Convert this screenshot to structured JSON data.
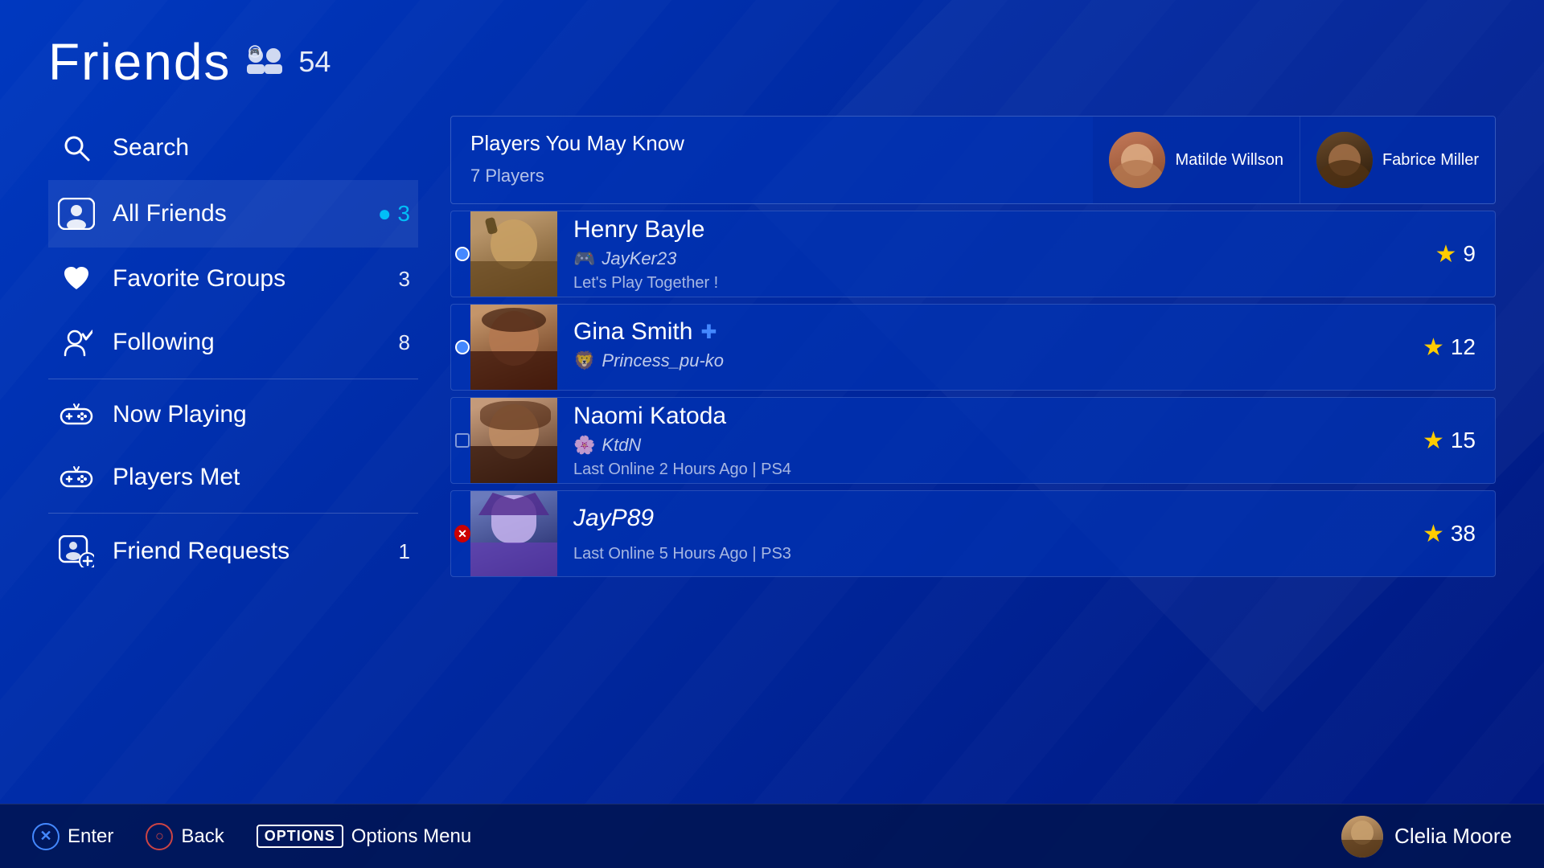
{
  "header": {
    "title": "Friends",
    "icon_label": "friends-icon",
    "count": "54"
  },
  "sidebar": {
    "items": [
      {
        "id": "search",
        "label": "Search",
        "icon": "search",
        "badge": "",
        "badge_type": "none",
        "divider_after": false
      },
      {
        "id": "all-friends",
        "label": "All Friends",
        "icon": "controller",
        "badge": "3",
        "badge_type": "online",
        "active": true,
        "divider_after": false
      },
      {
        "id": "favorite-groups",
        "label": "Favorite Groups",
        "icon": "heart",
        "badge": "3",
        "badge_type": "normal",
        "divider_after": false
      },
      {
        "id": "following",
        "label": "Following",
        "icon": "person-check",
        "badge": "8",
        "badge_type": "normal",
        "divider_after": true
      },
      {
        "id": "now-playing",
        "label": "Now Playing",
        "icon": "gamepad",
        "badge": "",
        "badge_type": "none",
        "divider_after": false
      },
      {
        "id": "players-met",
        "label": "Players Met",
        "icon": "gamepad",
        "badge": "",
        "badge_type": "none",
        "divider_after": true
      },
      {
        "id": "friend-requests",
        "label": "Friend Requests",
        "icon": "person-plus",
        "badge": "1",
        "badge_type": "normal",
        "divider_after": false
      }
    ]
  },
  "may_know": {
    "title": "Players You May Know",
    "player_count": "7 Players",
    "players": [
      {
        "name": "Matilde Willson"
      },
      {
        "name": "Fabrice Miller"
      }
    ]
  },
  "friends": [
    {
      "id": "henry-bayle",
      "name": "Henry Bayle",
      "psn": "JayKer23",
      "status": "Let's Play Together !",
      "status_type": "playing",
      "stars": "9",
      "indicator": "online",
      "ps_plus": false
    },
    {
      "id": "gina-smith",
      "name": "Gina Smith",
      "psn": "Princess_pu-ko",
      "status": "",
      "status_type": "online",
      "stars": "12",
      "indicator": "online",
      "ps_plus": true
    },
    {
      "id": "naomi-katoda",
      "name": "Naomi Katoda",
      "psn": "KtdN",
      "status": "Last Online 2 Hours Ago | PS4",
      "status_type": "offline",
      "stars": "15",
      "indicator": "offline",
      "ps_plus": false
    },
    {
      "id": "jayp89",
      "name": "JayP89",
      "psn": "",
      "status": "Last Online 5 Hours Ago | PS3",
      "status_type": "blocked",
      "stars": "38",
      "indicator": "blocked",
      "ps_plus": false
    }
  ],
  "bottom_bar": {
    "enter_label": "Enter",
    "back_label": "Back",
    "options_label": "Options Menu",
    "user_name": "Clelia Moore"
  }
}
